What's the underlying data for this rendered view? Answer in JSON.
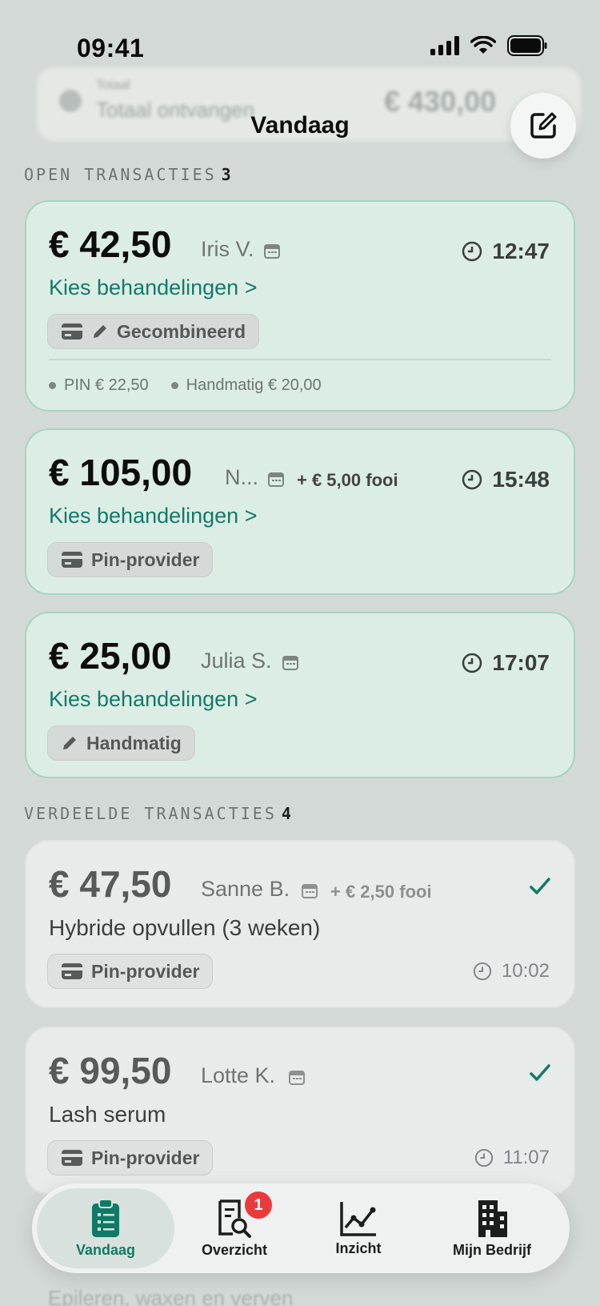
{
  "status": {
    "time": "09:41"
  },
  "background": {
    "label": "Totaal",
    "sublabel": "Totaal ontvangen",
    "amount": "€ 430,00",
    "peek": "Epileren, waxen en verven"
  },
  "header": {
    "title": "Vandaag"
  },
  "sections": {
    "open": {
      "label": "OPEN TRANSACTIES",
      "count": "3"
    },
    "done": {
      "label": "VERDEELDE TRANSACTIES",
      "count": "4"
    }
  },
  "open_transactions": [
    {
      "amount": "€ 42,50",
      "client": "Iris V.",
      "time": "12:47",
      "action": "Kies behandelingen >",
      "method": "Gecombineerd",
      "split": [
        "PIN € 22,50",
        "Handmatig € 20,00"
      ]
    },
    {
      "amount": "€ 105,00",
      "client": "N...",
      "tip": "+ € 5,00 fooi",
      "time": "15:48",
      "action": "Kies behandelingen >",
      "method": "Pin-provider"
    },
    {
      "amount": "€ 25,00",
      "client": "Julia S.",
      "time": "17:07",
      "action": "Kies behandelingen >",
      "method": "Handmatig"
    }
  ],
  "done_transactions": [
    {
      "amount": "€ 47,50",
      "client": "Sanne B.",
      "tip": "+ € 2,50 fooi",
      "treatment": "Hybride opvullen (3 weken)",
      "method": "Pin-provider",
      "time": "10:02"
    },
    {
      "amount": "€ 99,50",
      "client": "Lotte K.",
      "treatment": "Lash serum",
      "method": "Pin-provider",
      "time": "11:07"
    }
  ],
  "tabbar": {
    "tabs": [
      {
        "label": "Vandaag",
        "icon": "clipboard-list-icon",
        "active": true
      },
      {
        "label": "Overzicht",
        "icon": "receipt-search-icon",
        "badge": "1"
      },
      {
        "label": "Inzicht",
        "icon": "line-chart-icon"
      },
      {
        "label": "Mijn Bedrijf",
        "icon": "building-icon"
      }
    ]
  },
  "colors": {
    "accent": "#147a68",
    "badge": "#ea3a3a",
    "open_card": "#dcede6"
  }
}
